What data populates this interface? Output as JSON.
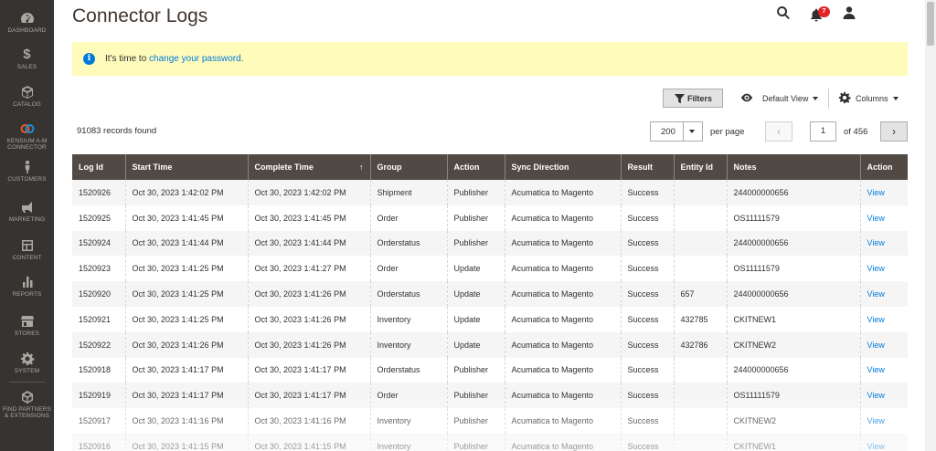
{
  "sidebar": {
    "items": [
      {
        "label": "DASHBOARD",
        "icon": "dashboard-icon"
      },
      {
        "label": "SALES",
        "icon": "dollar-icon"
      },
      {
        "label": "CATALOG",
        "icon": "box-icon"
      },
      {
        "label": "KENSIUM A-M CONNECTOR",
        "icon": "connector-icon"
      },
      {
        "label": "CUSTOMERS",
        "icon": "person-icon"
      },
      {
        "label": "MARKETING",
        "icon": "megaphone-icon"
      },
      {
        "label": "CONTENT",
        "icon": "layout-icon"
      },
      {
        "label": "REPORTS",
        "icon": "bar-chart-icon"
      },
      {
        "label": "STORES",
        "icon": "store-icon"
      },
      {
        "label": "SYSTEM",
        "icon": "gear-icon"
      },
      {
        "label": "FIND PARTNERS & EXTENSIONS",
        "icon": "cube-icon"
      }
    ]
  },
  "header": {
    "title": "Connector Logs",
    "notification_count": "7"
  },
  "message": {
    "prefix": "It's time to ",
    "link": "change your password",
    "suffix": "."
  },
  "toolbar": {
    "filters_label": "Filters",
    "view_label": "Default View",
    "columns_label": "Columns"
  },
  "pager": {
    "records": "91083 records found",
    "per_page_value": "200",
    "per_page_label": "per page",
    "prev": "‹",
    "current_page": "1",
    "of_pages": "of 456",
    "next": "›"
  },
  "table": {
    "columns": [
      "Log Id",
      "Start Time",
      "Complete Time",
      "Group",
      "Action",
      "Sync Direction",
      "Result",
      "Entity Id",
      "Notes",
      "Action"
    ],
    "sort_indicator": "↑",
    "rows": [
      [
        "1520926",
        "Oct 30, 2023 1:42:02 PM",
        "Oct 30, 2023 1:42:02 PM",
        "Shipment",
        "Publisher",
        "Acumatica to Magento",
        "Success",
        "",
        "244000000656",
        "View"
      ],
      [
        "1520925",
        "Oct 30, 2023 1:41:45 PM",
        "Oct 30, 2023 1:41:45 PM",
        "Order",
        "Publisher",
        "Acumatica to Magento",
        "Success",
        "",
        "OS11111579",
        "View"
      ],
      [
        "1520924",
        "Oct 30, 2023 1:41:44 PM",
        "Oct 30, 2023 1:41:44 PM",
        "Orderstatus",
        "Publisher",
        "Acumatica to Magento",
        "Success",
        "",
        "244000000656",
        "View"
      ],
      [
        "1520923",
        "Oct 30, 2023 1:41:25 PM",
        "Oct 30, 2023 1:41:27 PM",
        "Order",
        "Update",
        "Acumatica to Magento",
        "Success",
        "",
        "OS11111579",
        "View"
      ],
      [
        "1520920",
        "Oct 30, 2023 1:41:25 PM",
        "Oct 30, 2023 1:41:26 PM",
        "Orderstatus",
        "Update",
        "Acumatica to Magento",
        "Success",
        "657",
        "244000000656",
        "View"
      ],
      [
        "1520921",
        "Oct 30, 2023 1:41:25 PM",
        "Oct 30, 2023 1:41:26 PM",
        "Inventory",
        "Update",
        "Acumatica to Magento",
        "Success",
        "432785",
        "CKITNEW1",
        "View"
      ],
      [
        "1520922",
        "Oct 30, 2023 1:41:26 PM",
        "Oct 30, 2023 1:41:26 PM",
        "Inventory",
        "Update",
        "Acumatica to Magento",
        "Success",
        "432786",
        "CKITNEW2",
        "View"
      ],
      [
        "1520918",
        "Oct 30, 2023 1:41:17 PM",
        "Oct 30, 2023 1:41:17 PM",
        "Orderstatus",
        "Publisher",
        "Acumatica to Magento",
        "Success",
        "",
        "244000000656",
        "View"
      ],
      [
        "1520919",
        "Oct 30, 2023 1:41:17 PM",
        "Oct 30, 2023 1:41:17 PM",
        "Order",
        "Publisher",
        "Acumatica to Magento",
        "Success",
        "",
        "OS11111579",
        "View"
      ],
      [
        "1520917",
        "Oct 30, 2023 1:41:16 PM",
        "Oct 30, 2023 1:41:16 PM",
        "Inventory",
        "Publisher",
        "Acumatica to Magento",
        "Success",
        "",
        "CKITNEW2",
        "View"
      ],
      [
        "1520916",
        "Oct 30, 2023 1:41:15 PM",
        "Oct 30, 2023 1:41:15 PM",
        "Inventory",
        "Publisher",
        "Acumatica to Magento",
        "Success",
        "",
        "CKITNEW1",
        "View"
      ]
    ]
  }
}
